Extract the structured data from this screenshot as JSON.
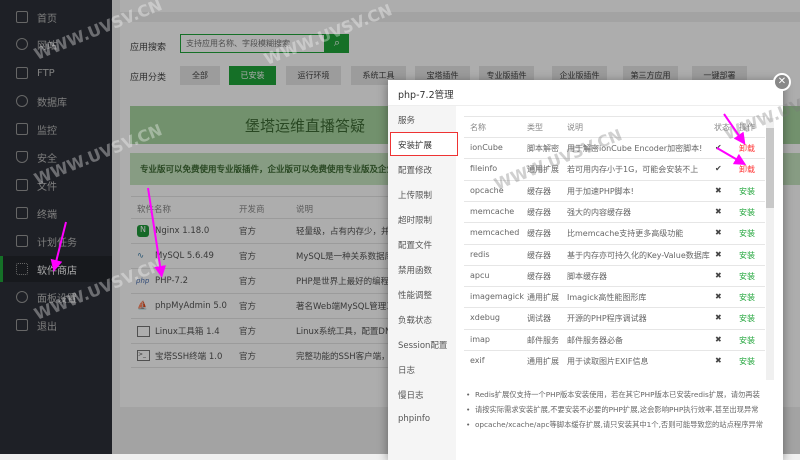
{
  "sidebar": {
    "items": [
      {
        "label": "首页"
      },
      {
        "label": "网站"
      },
      {
        "label": "FTP"
      },
      {
        "label": "数据库"
      },
      {
        "label": "监控"
      },
      {
        "label": "安全"
      },
      {
        "label": "文件"
      },
      {
        "label": "终端"
      },
      {
        "label": "计划任务"
      },
      {
        "label": "软件商店",
        "active": true
      },
      {
        "label": "面板设置"
      },
      {
        "label": "退出"
      }
    ]
  },
  "search": {
    "label": "应用搜索",
    "placeholder": "支持应用名称、字段模糊搜索"
  },
  "categories": {
    "label": "应用分类",
    "items": [
      "全部",
      "已安装",
      "运行环境",
      "系统工具",
      "宝塔插件",
      "专业版插件",
      "企业版插件",
      "第三方应用",
      "一键部署"
    ],
    "active": "已安装"
  },
  "banner": "堡塔运维直播答疑",
  "notice": "专业版可以免费使用专业版插件，企业版可以免费使用专业版及企业版",
  "table": {
    "headers": [
      "软件名称",
      "开发商",
      "说明"
    ],
    "rows": [
      {
        "name": "Nginx 1.18.0",
        "dev": "官方",
        "desc": "轻量级，占有内存少，并发"
      },
      {
        "name": "MySQL 5.6.49",
        "dev": "官方",
        "desc": "MySQL是一种关系数据库管"
      },
      {
        "name": "PHP-7.2",
        "dev": "官方",
        "desc": "PHP是世界上最好的编程语"
      },
      {
        "name": "phpMyAdmin 5.0",
        "dev": "官方",
        "desc": "著名Web端MySQL管理工具"
      },
      {
        "name": "Linux工具箱 1.4",
        "dev": "官方",
        "desc": "Linux系统工具，配置DNS、"
      },
      {
        "name": "宝塔SSH终端 1.0",
        "dev": "官方",
        "desc": "完整功能的SSH客户端，仅"
      }
    ]
  },
  "modal": {
    "title": "php-7.2管理",
    "menu": [
      "服务",
      "安装扩展",
      "配置修改",
      "上传限制",
      "超时限制",
      "配置文件",
      "禁用函数",
      "性能调整",
      "负载状态",
      "Session配置",
      "日志",
      "慢日志",
      "phpinfo"
    ],
    "active_menu": "安装扩展",
    "headers": [
      "名称",
      "类型",
      "说明",
      "状态",
      "操作"
    ],
    "rows": [
      {
        "name": "ionCube",
        "type": "脚本解密",
        "desc": "用于解密ionCube Encoder加密脚本!",
        "status": "✔",
        "action": "卸载",
        "installed": true
      },
      {
        "name": "fileinfo",
        "type": "通用扩展",
        "desc": "若可用内存小于1G，可能会安装不上",
        "status": "✔",
        "action": "卸载",
        "installed": true
      },
      {
        "name": "opcache",
        "type": "缓存器",
        "desc": "用于加速PHP脚本!",
        "status": "✖",
        "action": "安装",
        "installed": false
      },
      {
        "name": "memcache",
        "type": "缓存器",
        "desc": "强大的内容缓存器",
        "status": "✖",
        "action": "安装",
        "installed": false
      },
      {
        "name": "memcached",
        "type": "缓存器",
        "desc": "比memcache支持更多高级功能",
        "status": "✖",
        "action": "安装",
        "installed": false
      },
      {
        "name": "redis",
        "type": "缓存器",
        "desc": "基于内存亦可持久化的Key-Value数据库",
        "status": "✖",
        "action": "安装",
        "installed": false
      },
      {
        "name": "apcu",
        "type": "缓存器",
        "desc": "脚本缓存器",
        "status": "✖",
        "action": "安装",
        "installed": false
      },
      {
        "name": "imagemagick",
        "type": "通用扩展",
        "desc": "Imagick高性能图形库",
        "status": "✖",
        "action": "安装",
        "installed": false
      },
      {
        "name": "xdebug",
        "type": "调试器",
        "desc": "开源的PHP程序调试器",
        "status": "✖",
        "action": "安装",
        "installed": false
      },
      {
        "name": "imap",
        "type": "邮件服务",
        "desc": "邮件服务器必备",
        "status": "✖",
        "action": "安装",
        "installed": false
      },
      {
        "name": "exif",
        "type": "通用扩展",
        "desc": "用于读取图片EXIF信息",
        "status": "✖",
        "action": "安装",
        "installed": false
      }
    ],
    "notes": [
      "Redis扩展仅支持一个PHP版本安装使用，若在其它PHP版本已安装redis扩展，请勿再装",
      "请按实际需求安装扩展,不要安装不必要的PHP扩展,这会影响PHP执行效率,甚至出现异常",
      "opcache/xcache/apc等脚本缓存扩展,请只安装其中1个,否则可能导致您的站点程序异常"
    ]
  },
  "watermark": "WWW.UVSV.CN",
  "colors": {
    "green": "#20a53a",
    "red": "#ff3333",
    "accent_arrow": "#ff00ff"
  }
}
